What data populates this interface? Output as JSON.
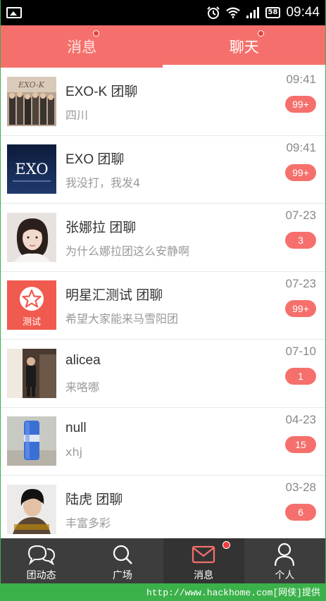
{
  "status_bar": {
    "time": "09:44",
    "battery": "58",
    "icons": [
      "image-icon",
      "alarm-icon",
      "wifi-icon",
      "signal-icon",
      "battery-icon"
    ]
  },
  "top_tabs": [
    {
      "label": "消息",
      "active": false,
      "has_dot": true
    },
    {
      "label": "聊天",
      "active": true,
      "has_dot": true
    }
  ],
  "chats": [
    {
      "name": "EXO-K 团聊",
      "preview": "四川",
      "time": "09:41",
      "badge": "99+",
      "avatar": "group-photo"
    },
    {
      "name": "EXO 团聊",
      "preview": "我没打，我发4",
      "time": "09:41",
      "badge": "99+",
      "avatar": "exo-logo",
      "avatar_text": "EXO"
    },
    {
      "name": "张娜拉 团聊",
      "preview": "为什么娜拉团这么安静啊",
      "time": "07-23",
      "badge": "3",
      "avatar": "portrait"
    },
    {
      "name": "明星汇测试 团聊",
      "preview": "希望大家能来马雪阳团",
      "time": "07-23",
      "badge": "99+",
      "avatar": "star-logo",
      "avatar_text": "测试"
    },
    {
      "name": "alicea",
      "preview": "来咯哪",
      "time": "07-10",
      "badge": "1",
      "avatar": "photo"
    },
    {
      "name": "null",
      "preview": "xhj",
      "time": "04-23",
      "badge": "15",
      "avatar": "photo"
    },
    {
      "name": "陆虎 团聊",
      "preview": "丰富多彩",
      "time": "03-28",
      "badge": "6",
      "avatar": "portrait"
    }
  ],
  "bottom_nav": [
    {
      "label": "团动态",
      "icon": "chat-bubbles-icon",
      "active": false
    },
    {
      "label": "广场",
      "icon": "search-icon",
      "active": false
    },
    {
      "label": "消息",
      "icon": "mail-icon",
      "active": true,
      "has_dot": true
    },
    {
      "label": "个人",
      "icon": "person-icon",
      "active": false
    }
  ],
  "watermark": "http://www.hackhome.com[网侠]提供",
  "colors": {
    "accent": "#f5706c",
    "nav_bg": "#3d3d3d",
    "nav_active_icon": "#f5706c"
  }
}
